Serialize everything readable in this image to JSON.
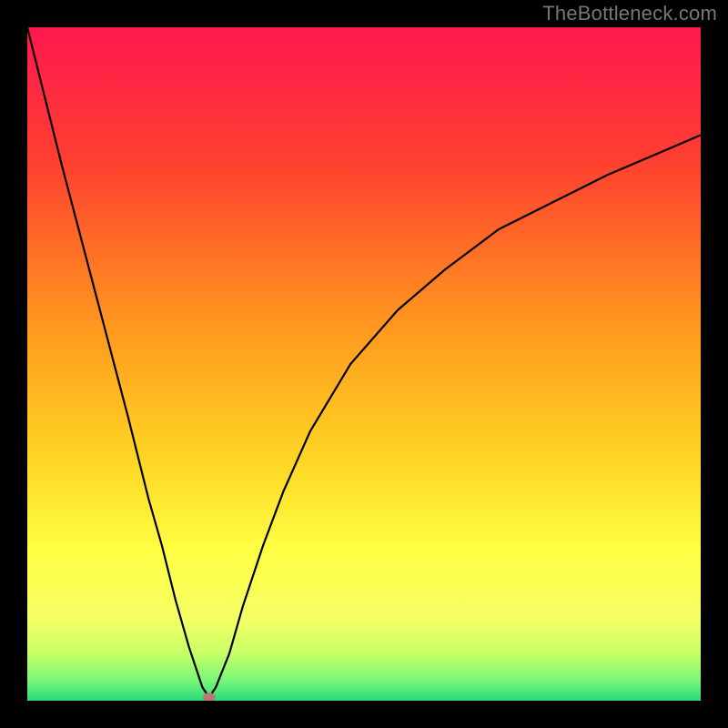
{
  "watermark": "TheBottleneck.com",
  "chart_data": {
    "type": "line",
    "title": "",
    "xlabel": "",
    "ylabel": "",
    "xlim": [
      0,
      100
    ],
    "ylim": [
      0,
      100
    ],
    "grid": false,
    "background_gradient": {
      "stops": [
        {
          "offset": 0.0,
          "color": "#ff1850"
        },
        {
          "offset": 0.2,
          "color": "#ff4030"
        },
        {
          "offset": 0.45,
          "color": "#ff9a1e"
        },
        {
          "offset": 0.65,
          "color": "#ffd825"
        },
        {
          "offset": 0.78,
          "color": "#ffff44"
        },
        {
          "offset": 0.88,
          "color": "#f5ff66"
        },
        {
          "offset": 0.93,
          "color": "#c7ff66"
        },
        {
          "offset": 0.97,
          "color": "#79f77a"
        },
        {
          "offset": 1.0,
          "color": "#29d97a"
        }
      ]
    },
    "series": [
      {
        "name": "bottleneck-curve",
        "stroke": "#000000",
        "stroke_width": 2.2,
        "x": [
          0,
          5,
          10,
          15,
          18,
          20,
          22,
          24,
          26,
          27,
          28,
          30,
          32,
          35,
          38,
          42,
          48,
          55,
          62,
          70,
          78,
          86,
          93,
          100
        ],
        "y": [
          100,
          80,
          61,
          42,
          30,
          23,
          15,
          8,
          2,
          0.5,
          2,
          7,
          14,
          23,
          31,
          40,
          50,
          58,
          64,
          70,
          74,
          78,
          81,
          84
        ]
      }
    ],
    "marker": {
      "name": "optimal-point",
      "x": 27,
      "y": 0.5,
      "color": "#bb786c",
      "rx": 7,
      "ry": 5
    }
  }
}
